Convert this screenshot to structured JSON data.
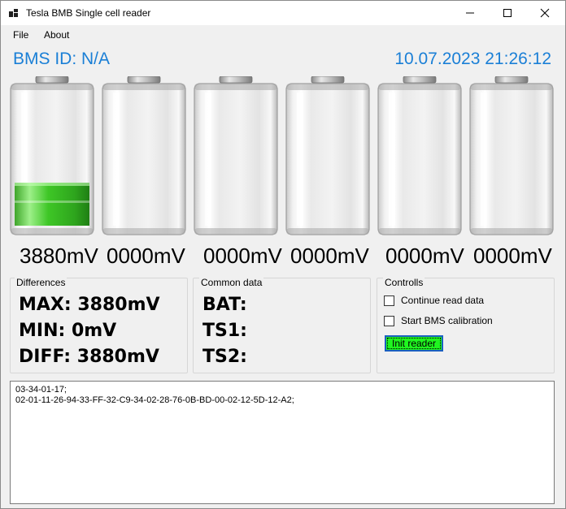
{
  "window": {
    "title": "Tesla BMB Single cell reader",
    "controls": [
      "minimize-icon",
      "maximize-icon",
      "close-icon"
    ]
  },
  "menu": {
    "file": "File",
    "about": "About"
  },
  "header": {
    "bms_id": "BMS ID: N/A",
    "datetime": "10.07.2023 21:26:12",
    "accent_color": "#1a7fd6"
  },
  "cells": [
    {
      "voltage": "3880mV",
      "fill_fraction": 0.34
    },
    {
      "voltage": "0000mV",
      "fill_fraction": 0
    },
    {
      "voltage": "0000mV",
      "fill_fraction": 0
    },
    {
      "voltage": "0000mV",
      "fill_fraction": 0
    },
    {
      "voltage": "0000mV",
      "fill_fraction": 0
    },
    {
      "voltage": "0000mV",
      "fill_fraction": 0
    }
  ],
  "differences": {
    "title": "Differences",
    "max": "MAX: 3880mV",
    "min": "MIN: 0mV",
    "diff": "DIFF: 3880mV"
  },
  "common": {
    "title": "Common data",
    "bat": "BAT:",
    "ts1": "TS1:",
    "ts2": "TS2:"
  },
  "controls": {
    "title": "Controlls",
    "continue_read": {
      "label": "Continue read data",
      "checked": false
    },
    "start_calibration": {
      "label": "Start BMS calibration",
      "checked": false
    },
    "init_button": "Init reader",
    "init_button_color": "#1ff51f"
  },
  "log": {
    "lines": [
      "03-34-01-17;",
      "02-01-11-26-94-33-FF-32-C9-34-02-28-76-0B-BD-00-02-12-5D-12-A2;"
    ]
  }
}
